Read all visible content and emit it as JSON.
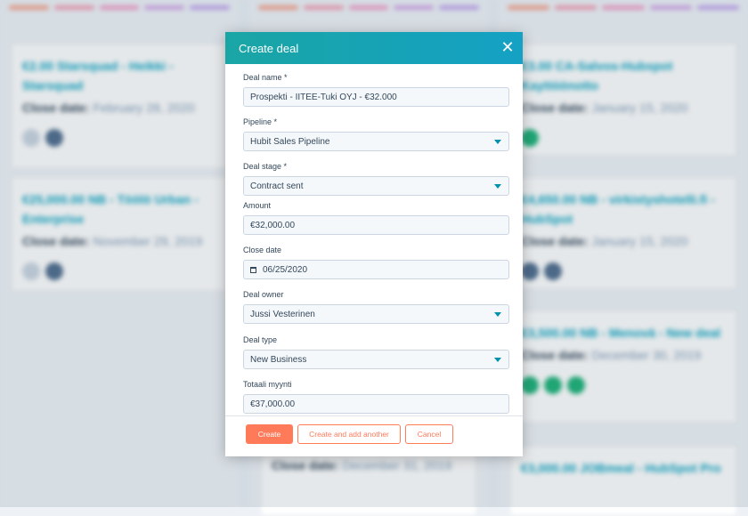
{
  "background": {
    "columns": [
      {
        "strip_colors": [
          "#f8a38f",
          "#f5a0b5",
          "#f2a0c8",
          "#d6a8e8",
          "#c5a6ef"
        ],
        "cards": [
          {
            "title": "€2.00 Starsquad - Heikki - Starsquad",
            "date_label": "Close date:",
            "date": "February 28, 2020"
          },
          {
            "title": "€25,000.00 NB - Töölö Urban - Enterprise",
            "date_label": "Close date:",
            "date": "November 29, 2019"
          }
        ]
      },
      {
        "strip_colors": [
          "#f8a38f",
          "#f5a0b5",
          "#f2a0c8",
          "#d6a8e8",
          "#c5a6ef"
        ],
        "cards": [
          {
            "title": "",
            "date_label": "Close date:",
            "date": "December 31, 2019"
          }
        ]
      },
      {
        "strip_colors": [
          "#f8a38f",
          "#f5a0b5",
          "#f2a0c8",
          "#d6a8e8",
          "#c5a6ef"
        ],
        "cards": [
          {
            "title": "€3.00 CA-Salvos-Hubspot Kayttöönotto",
            "date_label": "Close date:",
            "date": "January 15, 2020"
          },
          {
            "title": "€4,650.00 NB - virkistyshotelli.fi - HubSpot",
            "date_label": "Close date:",
            "date": "January 15, 2020"
          },
          {
            "title": "€3,500.00 NB - Menovä - New deal",
            "date_label": "Close date:",
            "date": "December 30, 2019"
          },
          {
            "title": "€3,000.00 JOBmeal - HubSpot Pro",
            "date_label": "",
            "date": ""
          }
        ]
      }
    ]
  },
  "modal": {
    "title": "Create deal",
    "close_symbol": "✕",
    "fields": {
      "deal_name": {
        "label": "Deal name *",
        "value": "Prospekti - IITEE-Tuki OYJ - €32.000"
      },
      "pipeline": {
        "label": "Pipeline *",
        "value": "Hubit Sales Pipeline"
      },
      "deal_stage": {
        "label": "Deal stage *",
        "value": "Contract sent"
      },
      "amount": {
        "label": "Amount",
        "value": "€32,000.00"
      },
      "close_date": {
        "label": "Close date",
        "value": "06/25/2020"
      },
      "deal_owner": {
        "label": "Deal owner",
        "value": "Jussi Vesterinen"
      },
      "deal_type": {
        "label": "Deal type",
        "value": "New Business"
      },
      "totaali_myynti": {
        "label": "Totaali myynti",
        "value": "€37,000.00"
      }
    },
    "buttons": {
      "create": "Create",
      "create_another": "Create and add another",
      "cancel": "Cancel"
    }
  },
  "colors": {
    "header_gradient_start": "#1aa5a5",
    "header_gradient_end": "#14a1c4",
    "accent_orange": "#ff7a59",
    "link_teal": "#0aa4c2"
  }
}
